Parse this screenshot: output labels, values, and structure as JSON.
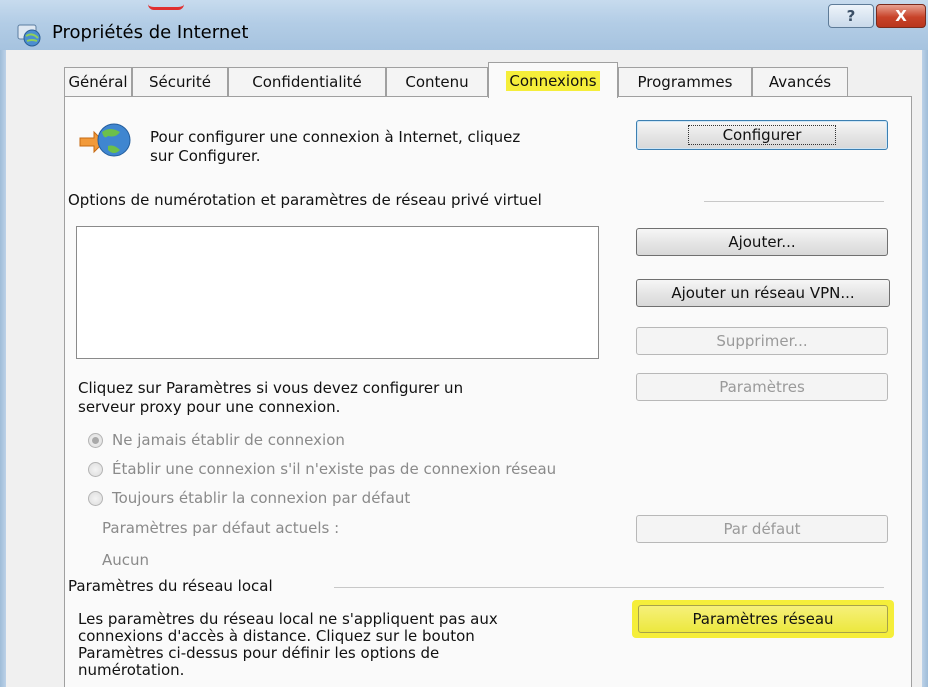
{
  "window": {
    "title": "Propriétés de Internet",
    "help_glyph": "?",
    "close_glyph": "X"
  },
  "tabs": [
    {
      "label": "Général"
    },
    {
      "label": "Sécurité"
    },
    {
      "label": "Confidentialité"
    },
    {
      "label": "Contenu"
    },
    {
      "label": "Connexions",
      "active": true
    },
    {
      "label": "Programmes"
    },
    {
      "label": "Avancés"
    }
  ],
  "setup": {
    "text_line1": "Pour configurer une connexion à Internet, cliquez",
    "text_line2": "sur Configurer.",
    "button": "Configurer"
  },
  "dialup": {
    "heading": "Options de numérotation et paramètres de réseau privé virtuel",
    "add_button": "Ajouter...",
    "add_vpn_button": "Ajouter un réseau VPN...",
    "remove_button": "Supprimer...",
    "settings_button": "Paramètres",
    "proxy_text_line1": "Cliquez sur Paramètres si vous devez configurer un",
    "proxy_text_line2": "serveur proxy pour une connexion.",
    "radios": [
      {
        "label": "Ne jamais établir de connexion",
        "selected": true
      },
      {
        "label": "Établir une connexion s'il n'existe pas de connexion réseau",
        "selected": false
      },
      {
        "label": "Toujours établir la connexion par défaut",
        "selected": false
      }
    ],
    "default_label": "Paramètres par défaut actuels :",
    "default_value": "Aucun",
    "default_button": "Par défaut"
  },
  "lan": {
    "heading": "Paramètres du réseau local",
    "text_line1": "Les paramètres du réseau local ne s'appliquent pas aux",
    "text_line2": "connexions d'accès à distance. Cliquez sur le bouton",
    "text_line3": "Paramètres ci-dessus pour définir les options de",
    "text_line4": "numérotation.",
    "button": "Paramètres réseau"
  },
  "colors": {
    "highlight": "#f5ee3a",
    "titlebar": "#b3cde6",
    "close_button": "#c8432a"
  }
}
